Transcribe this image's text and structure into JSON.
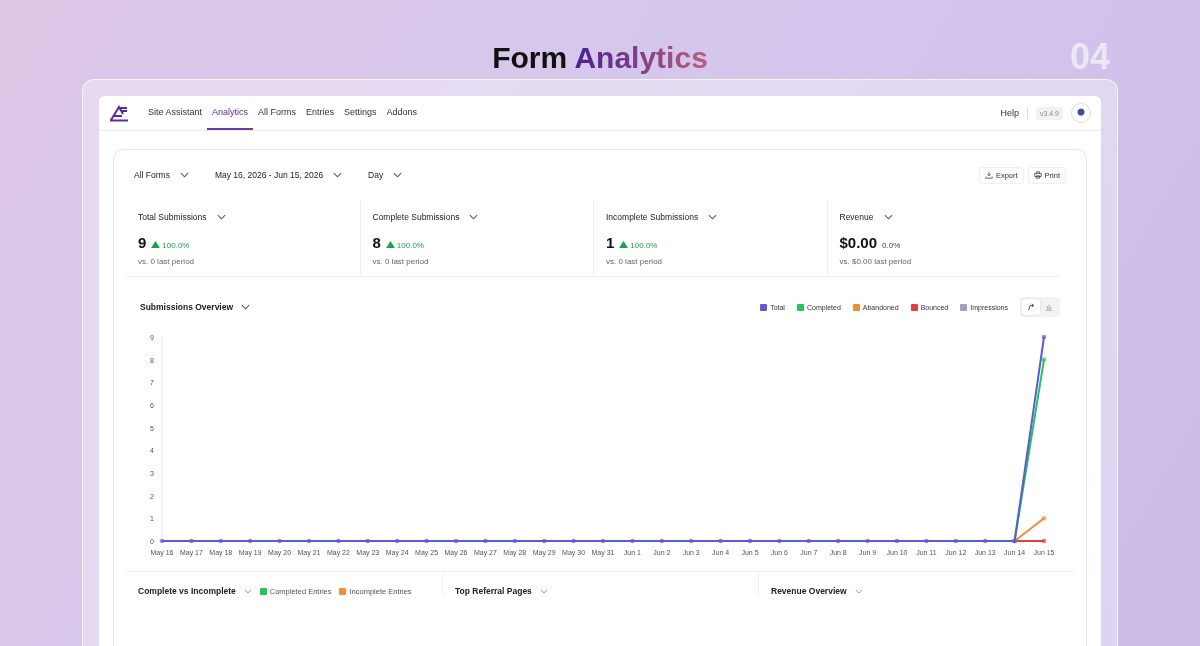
{
  "heading": {
    "plain": "Form",
    "accent": "Analytics",
    "number": "04"
  },
  "nav": {
    "items": [
      {
        "label": "Site Assistant",
        "selected": false
      },
      {
        "label": "Analytics",
        "selected": true
      },
      {
        "label": "All Forms",
        "selected": false
      },
      {
        "label": "Entries",
        "selected": false
      },
      {
        "label": "Settings",
        "selected": false
      },
      {
        "label": "Addons",
        "selected": false
      }
    ],
    "help": "Help",
    "version": "v3.4.9"
  },
  "filters": [
    {
      "label": "All Forms"
    },
    {
      "label": "May 16, 2026 - Jun 15, 2026"
    },
    {
      "label": "Day"
    }
  ],
  "actions": [
    {
      "kind": "export",
      "label": "Export"
    },
    {
      "kind": "print",
      "label": "Print"
    }
  ],
  "stats": [
    {
      "label": "Total Submissions",
      "value": "9",
      "change": "100.0%",
      "up": true,
      "compare": "vs. 0 last period"
    },
    {
      "label": "Complete Submissions",
      "value": "8",
      "change": "100.0%",
      "up": true,
      "compare": "vs. 0 last period"
    },
    {
      "label": "Incomplete Submissions",
      "value": "1",
      "change": "100.0%",
      "up": true,
      "compare": "vs. 0 last period"
    },
    {
      "label": "Revenue",
      "value": "$0.00",
      "change": "0.0%",
      "up": false,
      "compare": "vs. $0.00 last period"
    }
  ],
  "overview": {
    "title": "Submissions Overview",
    "view_toggle": [
      {
        "kind": "line",
        "selected": true
      },
      {
        "kind": "bar",
        "selected": false
      }
    ],
    "chart_data": {
      "type": "line",
      "categories": [
        "May 16",
        "May 17",
        "May 18",
        "May 19",
        "May 20",
        "May 21",
        "May 22",
        "May 23",
        "May 24",
        "May 25",
        "May 26",
        "May 27",
        "May 28",
        "May 29",
        "May 30",
        "May 31",
        "Jun 1",
        "Jun 2",
        "Jun 3",
        "Jun 4",
        "Jun 5",
        "Jun 6",
        "Jun 7",
        "Jun 8",
        "Jun 9",
        "Jun 10",
        "Jun 11",
        "Jun 12",
        "Jun 13",
        "Jun 14",
        "Jun 15"
      ],
      "ylim": [
        0,
        9
      ],
      "yticks": [
        0,
        1,
        2,
        3,
        4,
        5,
        6,
        7,
        8,
        9
      ],
      "series": [
        {
          "name": "Total",
          "color": "#5b5bd6",
          "values": [
            0,
            0,
            0,
            0,
            0,
            0,
            0,
            0,
            0,
            0,
            0,
            0,
            0,
            0,
            0,
            0,
            0,
            0,
            0,
            0,
            0,
            0,
            0,
            0,
            0,
            0,
            0,
            0,
            0,
            0,
            9
          ]
        },
        {
          "name": "Completed",
          "color": "#22c55e",
          "values": [
            null,
            null,
            null,
            null,
            null,
            null,
            null,
            null,
            null,
            null,
            null,
            null,
            null,
            null,
            null,
            null,
            null,
            null,
            null,
            null,
            null,
            null,
            null,
            null,
            null,
            null,
            null,
            null,
            null,
            0,
            8
          ]
        },
        {
          "name": "Abandoned",
          "color": "#f28c38",
          "values": [
            null,
            null,
            null,
            null,
            null,
            null,
            null,
            null,
            null,
            null,
            null,
            null,
            null,
            null,
            null,
            null,
            null,
            null,
            null,
            null,
            null,
            null,
            null,
            null,
            null,
            null,
            null,
            null,
            null,
            0,
            1
          ]
        },
        {
          "name": "Bounced",
          "color": "#e53e3e",
          "values": [
            null,
            null,
            null,
            null,
            null,
            null,
            null,
            null,
            null,
            null,
            null,
            null,
            null,
            null,
            null,
            null,
            null,
            null,
            null,
            null,
            null,
            null,
            null,
            null,
            null,
            null,
            null,
            null,
            null,
            0,
            0
          ]
        },
        {
          "name": "Impressions",
          "color": "#9ca3b8",
          "values": [
            null,
            null,
            null,
            null,
            null,
            null,
            null,
            null,
            null,
            null,
            null,
            null,
            null,
            null,
            null,
            null,
            null,
            null,
            null,
            null,
            null,
            null,
            null,
            null,
            null,
            null,
            null,
            null,
            null,
            null,
            null
          ]
        }
      ]
    }
  },
  "panels": [
    {
      "title": "Complete vs Incomplete",
      "legend": [
        {
          "label": "Completed Entries",
          "color": "#22c55e"
        },
        {
          "label": "Incomplete Entries",
          "color": "#f28c38"
        }
      ]
    },
    {
      "title": "Top Referral Pages"
    },
    {
      "title": "Revenue Overview"
    }
  ]
}
